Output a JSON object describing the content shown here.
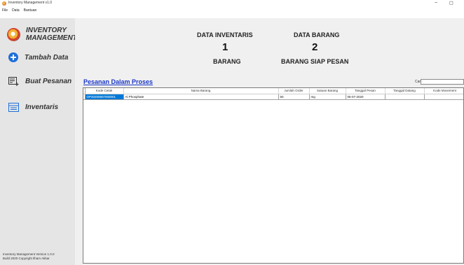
{
  "window": {
    "title": "Inventory Management v1.0",
    "minimize": "−",
    "maximize": "◻"
  },
  "menu": [
    "File",
    "Data",
    "Bantuan"
  ],
  "sidebar": {
    "logo_line1": "INVENTORY",
    "logo_line2": "MANAGEMENT",
    "items": [
      {
        "label": "Tambah Data",
        "icon": "plus-circle-icon"
      },
      {
        "label": "Buat Pesanan",
        "icon": "add-list-icon"
      },
      {
        "label": "Inventaris",
        "icon": "list-icon"
      }
    ],
    "version_line1": "Inventory Management Version 1.0.0",
    "version_line2": "Build 2020 Copyright Ilham Akbar"
  },
  "header": {
    "inventaris": {
      "title": "DATA INVENTARIS",
      "value": "1",
      "unit": "BARANG"
    },
    "barang": {
      "title": "DATA BARANG",
      "value": "2",
      "unit": "BARANG SIAP PESAN"
    }
  },
  "panel": {
    "title": "Pesanan Dalam Proses",
    "search_label": "Cari",
    "search_value": ""
  },
  "table": {
    "columns": [
      "Kode Cetak",
      "Nama Barang",
      "Jumlah Order",
      "Satuan Barang",
      "Tanggal Pesan",
      "Tanggal Datang",
      "Kode Movement"
    ],
    "rows": [
      [
        "OP20200607000001",
        "Al Phosphate",
        "50",
        "mg",
        "06-07-2020",
        "",
        ""
      ]
    ]
  },
  "colors": {
    "accent": "#1e6fd9",
    "selection": "#0078d7",
    "panel_title": "#1a37c9",
    "sidebar_bg": "#e5e5e5",
    "content_bg": "#f0f0f0"
  }
}
